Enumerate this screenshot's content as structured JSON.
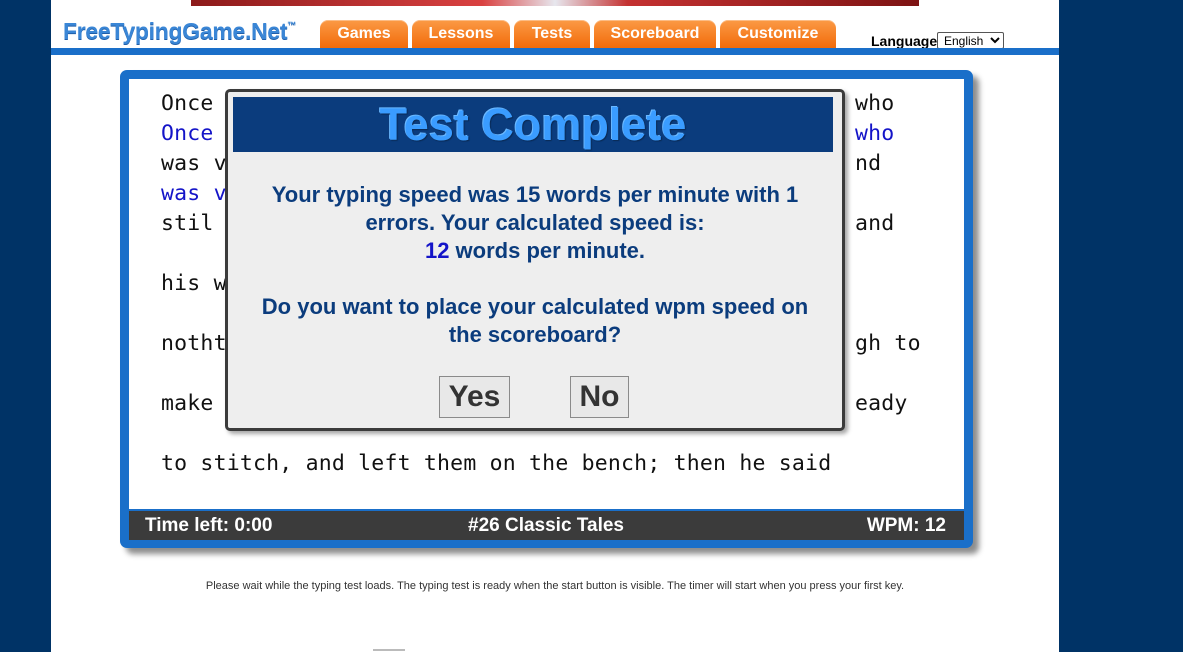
{
  "header": {
    "logo_text": "FreeTypingGame.Net",
    "logo_tm": "™",
    "nav": [
      "Games",
      "Lessons",
      "Tests",
      "Scoreboard",
      "Customize"
    ],
    "language_label": "Language",
    "language_selected": "English"
  },
  "typing_text": {
    "lines": [
      {
        "left": "Once",
        "right": "who",
        "typed": false
      },
      {
        "left": "Once",
        "right": "who",
        "typed": true
      },
      {
        "left": "was v",
        "right": "nd",
        "typed": false
      },
      {
        "left": "was v",
        "right": "",
        "typed": true
      },
      {
        "left": "stil",
        "right": "and",
        "typed": false
      },
      {
        "left": "his w",
        "right": "",
        "typed": false
      },
      {
        "left": "notht",
        "right": "gh to",
        "typed": false
      },
      {
        "left": "make",
        "right": "eady",
        "typed": false
      },
      {
        "left": "to stitch, and left them on the bench; then he said",
        "right": "",
        "typed": false
      }
    ]
  },
  "status_bar": {
    "time_left": "Time left: 0:00",
    "test_name": "#26 Classic Tales",
    "wpm": "WPM: 12"
  },
  "modal": {
    "title": "Test Complete",
    "speed_line_1": "Your typing speed was 15 words per minute with 1",
    "speed_line_2": "errors. Your calculated speed is:",
    "calculated_wpm": "12",
    "calculated_suffix": " words per minute.",
    "question_line_1": "Do you want to place your calculated wpm speed on",
    "question_line_2": "the scoreboard?",
    "yes_label": "Yes",
    "no_label": "No"
  },
  "footer": {
    "note": "Please wait while the typing test loads. The typing test is ready when the start button is visible. The timer will start when you press your first key."
  },
  "colors": {
    "background": "#003366",
    "nav_orange": "#f7841e",
    "frame_blue": "#1a6fc9",
    "modal_header": "#0b3c7d",
    "typed_text": "#1414c8"
  }
}
